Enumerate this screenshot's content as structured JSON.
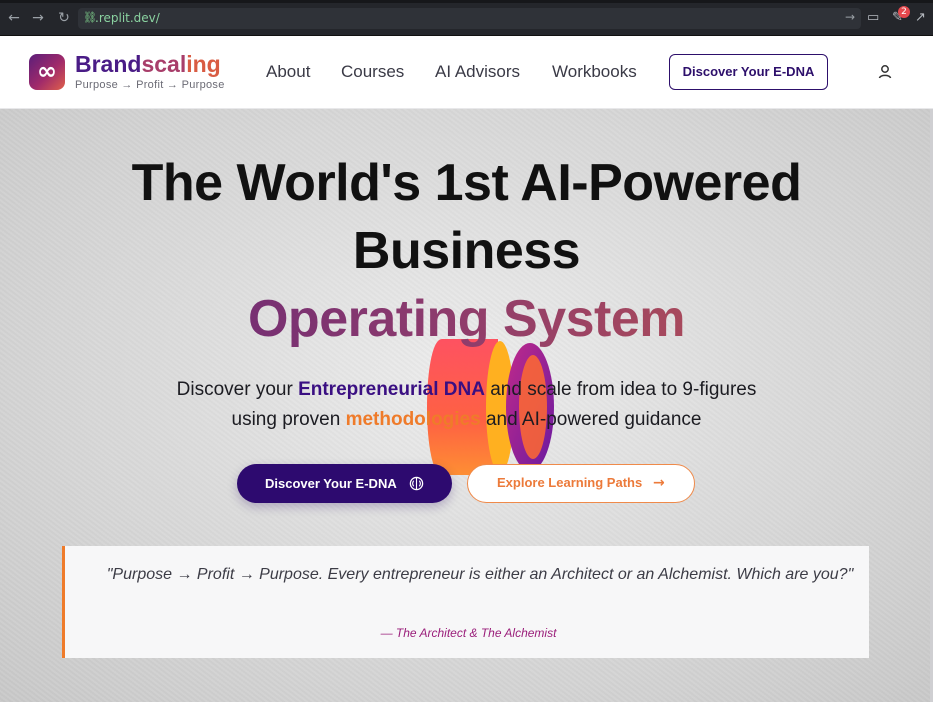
{
  "browser": {
    "url_prefix": "",
    "url_domain": ".replit.dev/",
    "notification_count": "2"
  },
  "header": {
    "brand_part1": "Brand",
    "brand_part2": "scal",
    "brand_part3": "ing",
    "tagline": "Purpose → Profit → Purpose",
    "logo_symbol": "∞",
    "nav": [
      "About",
      "Courses",
      "AI Advisors",
      "Workbooks"
    ],
    "cta_label": "Discover Your E-DNA"
  },
  "hero": {
    "line1": "The World's 1st AI-Powered",
    "line2": "Business",
    "line3": "Operating System",
    "sub_line1_pre": "Discover your ",
    "sub_line1_hl": "Entrepreneurial DNA",
    "sub_line1_post": " and scale from idea to 9-figures",
    "sub_line2_pre": "using proven ",
    "sub_line2_hl": "methodologies",
    "sub_line2_post": " and AI-powered guidance",
    "primary_button": "Discover Your E-DNA",
    "secondary_button": "Explore Learning Paths"
  },
  "quote": {
    "text": "\"Purpose → Profit → Purpose. Every entrepreneur is either an Architect or an Alchemist. Which are you?\"",
    "author": "— The Architect & The Alchemist"
  },
  "colors": {
    "brand_purple": "#2d0a6f",
    "accent_orange": "#ef7b2a",
    "gradient_start": "#5a2078",
    "gradient_end": "#c2574c"
  },
  "icons": {
    "back": "arrow-left-icon",
    "forward": "arrow-right-icon",
    "reload": "reload-icon",
    "link": "link-icon",
    "user": "user-icon",
    "brain": "brain-icon"
  }
}
